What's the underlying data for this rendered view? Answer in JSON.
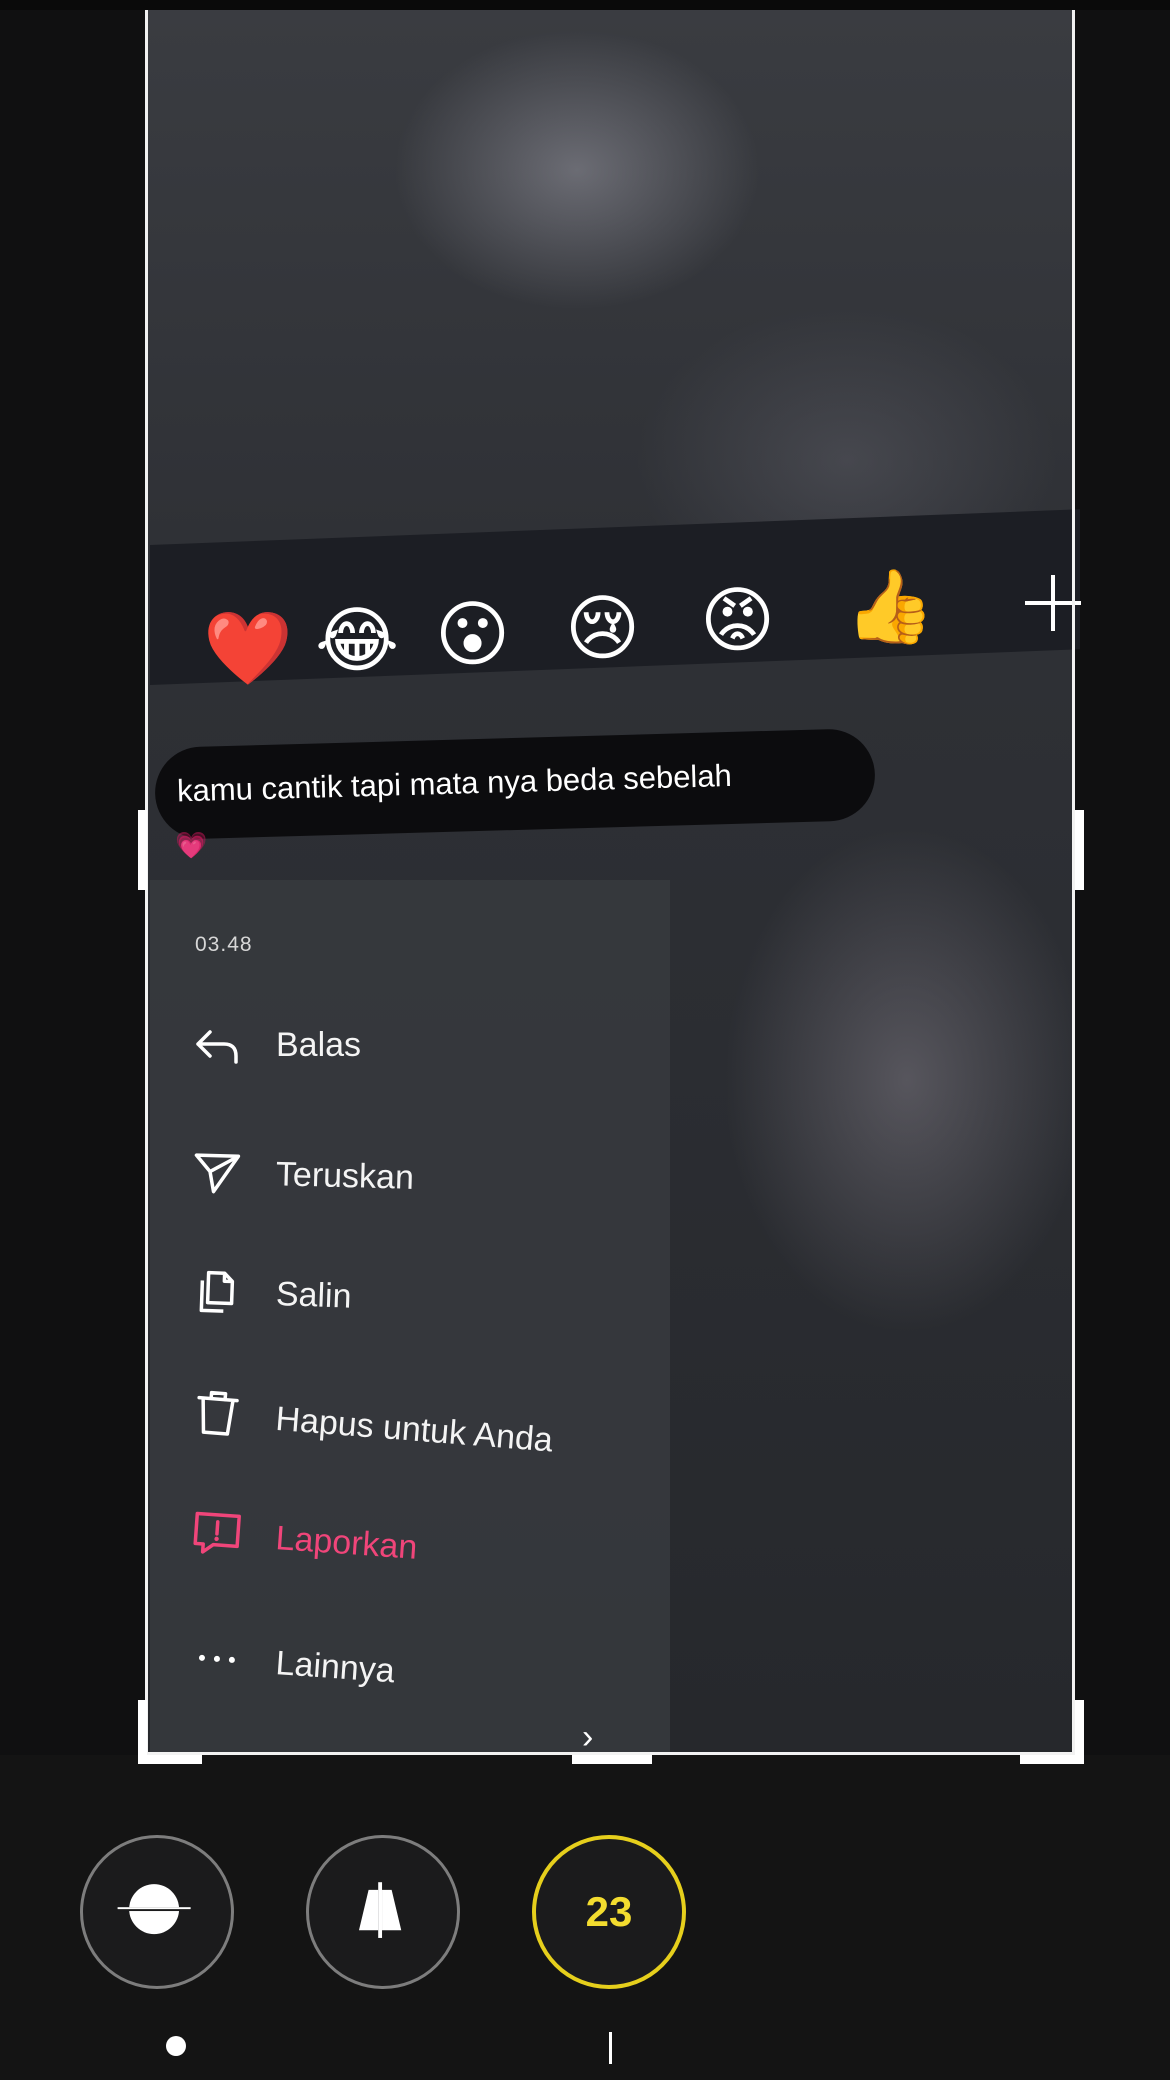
{
  "reactions": {
    "emojis": [
      "❤️",
      "😂",
      "😮",
      "😢",
      "😡",
      "👍"
    ],
    "more_icon": "plus-icon"
  },
  "message": {
    "text": "kamu cantik tapi mata nya beda sebelah",
    "reaction": "💗"
  },
  "menu": {
    "time": "03.48",
    "items": [
      {
        "label": "Balas",
        "icon": "reply-icon"
      },
      {
        "label": "Teruskan",
        "icon": "send-icon"
      },
      {
        "label": "Salin",
        "icon": "copy-icon"
      },
      {
        "label": "Hapus untuk Anda",
        "icon": "trash-icon"
      },
      {
        "label": "Laporkan",
        "icon": "report-icon"
      },
      {
        "label": "Lainnya",
        "icon": "more-icon"
      }
    ]
  },
  "toolbar": {
    "count": "23",
    "tools": [
      "level-icon",
      "perspective-icon",
      "rotation-counter"
    ]
  },
  "colors": {
    "danger": "#f0457a",
    "accent_yellow": "#e6cf1c"
  }
}
